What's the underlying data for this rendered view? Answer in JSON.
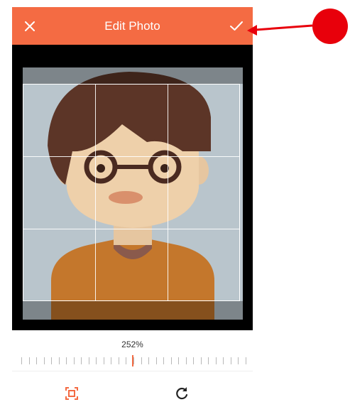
{
  "header": {
    "title": "Edit Photo",
    "close_icon": "close-icon",
    "confirm_icon": "checkmark-icon",
    "background": "#f46b43"
  },
  "editor": {
    "zoom_label": "252%",
    "zoom_percent": 252,
    "grid": "3x3",
    "accent": "#f46b43"
  },
  "toolbar": {
    "crop_icon": "crop-frame-icon",
    "rotate_icon": "rotate-icon"
  },
  "annotation": {
    "color": "#e8000b",
    "marker": "red-dot",
    "pointer": "arrow-to-confirm"
  }
}
